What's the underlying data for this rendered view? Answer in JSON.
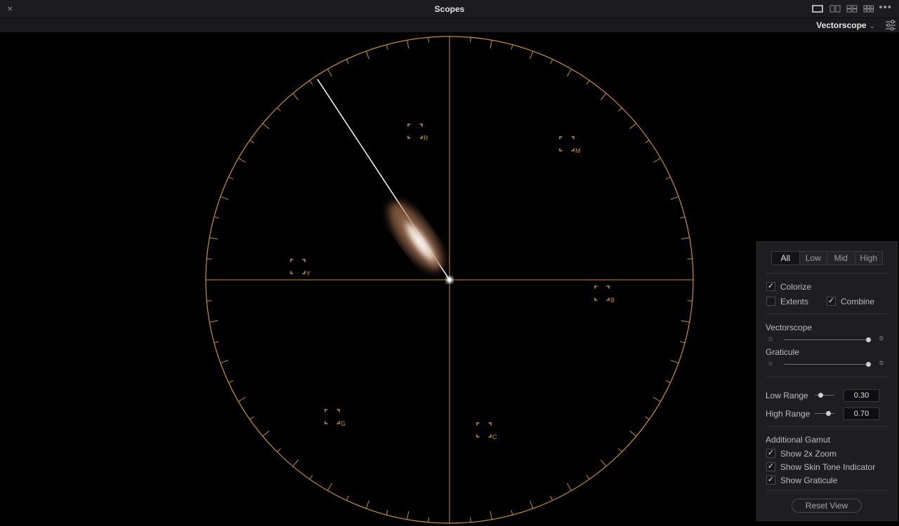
{
  "window": {
    "title": "Scopes",
    "close_glyph": "×",
    "more_glyph": "•••"
  },
  "toolbar": {
    "scope_type": "Vectorscope"
  },
  "vectorscope": {
    "graticule_color": "#c8922a",
    "targets": [
      "R",
      "M",
      "Y",
      "B",
      "G",
      "C"
    ]
  },
  "panel": {
    "range_tabs": [
      "All",
      "Low",
      "Mid",
      "High"
    ],
    "active_range": "All",
    "colorize": {
      "label": "Colorize",
      "checked": true
    },
    "extents": {
      "label": "Extents",
      "checked": false
    },
    "combine": {
      "label": "Combine",
      "checked": true
    },
    "vectorscope_brightness": {
      "label": "Vectorscope",
      "value": 1.0
    },
    "graticule_brightness": {
      "label": "Graticule",
      "value": 1.0
    },
    "low_range": {
      "label": "Low Range",
      "value": "0.30"
    },
    "high_range": {
      "label": "High Range",
      "value": "0.70"
    },
    "additional_gamut": {
      "label": "Additional Gamut"
    },
    "show_2x_zoom": {
      "label": "Show 2x Zoom",
      "checked": true
    },
    "show_skin_tone": {
      "label": "Show Skin Tone Indicator",
      "checked": true
    },
    "show_graticule": {
      "label": "Show Graticule",
      "checked": true
    },
    "reset_label": "Reset View"
  }
}
